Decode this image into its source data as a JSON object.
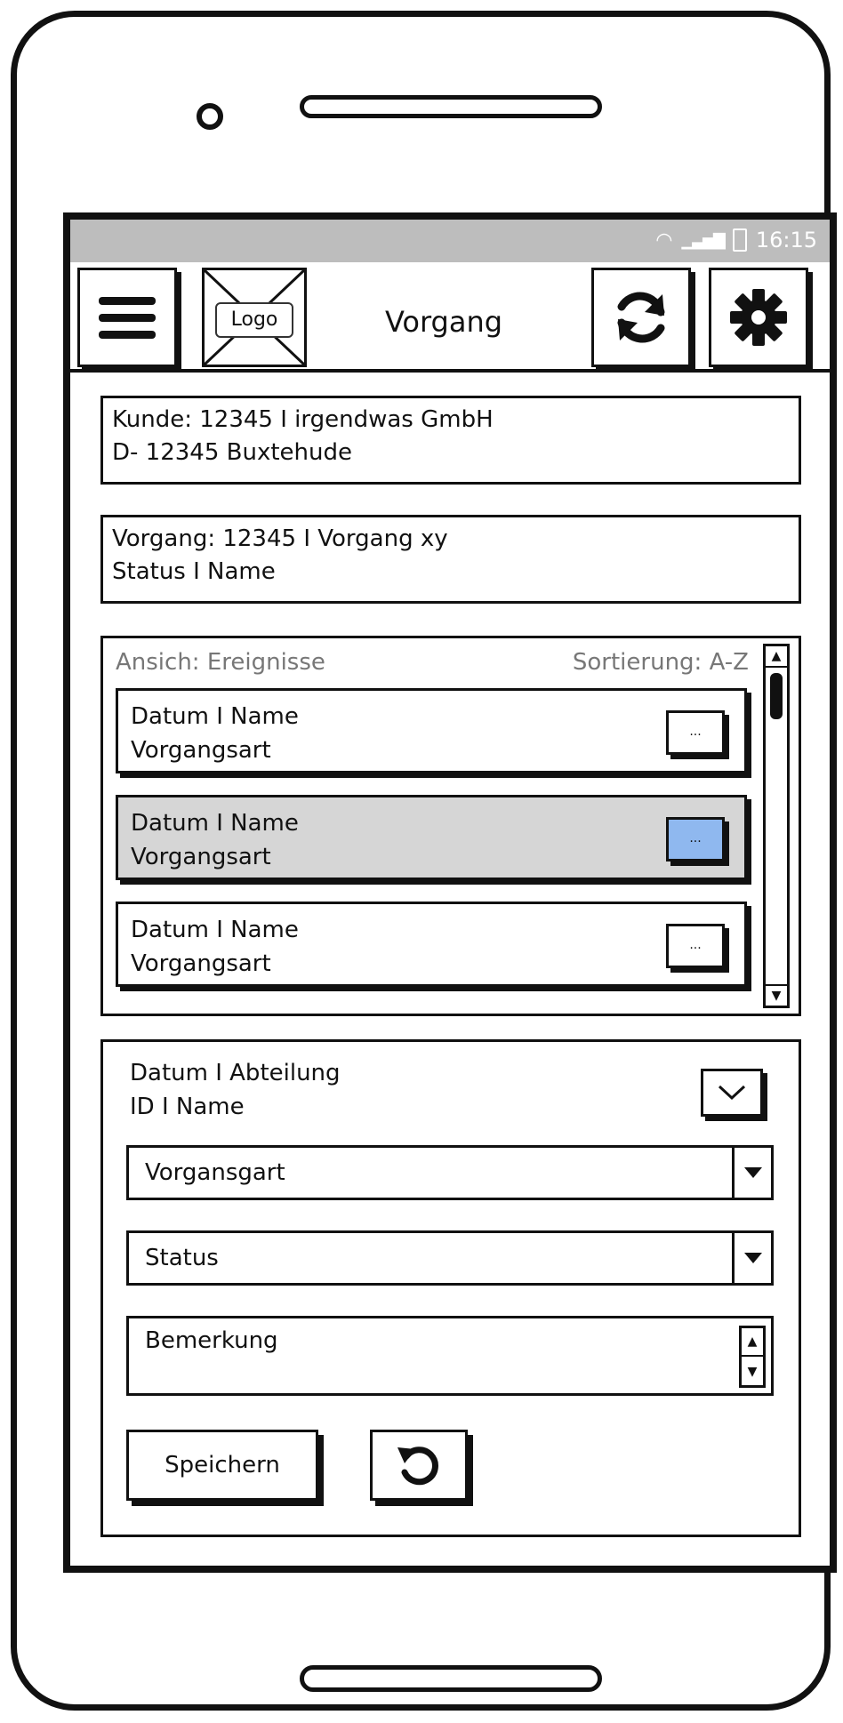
{
  "statusbar": {
    "time": "16:15",
    "wifi_icon": "wifi-icon",
    "signal_icon": "signal-icon",
    "battery_icon": "battery-icon"
  },
  "header": {
    "menu_icon": "hamburger-menu-icon",
    "logo_text": "Logo",
    "title": "Vorgang",
    "sync_icon": "sync-icon",
    "settings_icon": "gear-icon"
  },
  "customer": {
    "line1": "Kunde: 12345 I irgendwas GmbH",
    "line2": "D- 12345 Buxtehude"
  },
  "process": {
    "line1": "Vorgang: 12345 I Vorgang xy",
    "line2": "Status I Name"
  },
  "events": {
    "view_label": "Ansich: Ereignisse",
    "sort_label": "Sortierung: A-Z",
    "items": [
      {
        "line1": "Datum I Name",
        "line2": "Vorgangsart",
        "button": "...",
        "selected": false
      },
      {
        "line1": "Datum I Name",
        "line2": "Vorgangsart",
        "button": "...",
        "selected": true
      },
      {
        "line1": "Datum I Name",
        "line2": "Vorgangsart",
        "button": "...",
        "selected": false
      }
    ]
  },
  "detail": {
    "line1": "Datum I Abteilung",
    "line2": "ID I Name",
    "type_select": "Vorgansgart",
    "status_select": "Status",
    "remark_placeholder": "Bemerkung",
    "save_label": "Speichern",
    "undo_icon": "undo-icon"
  },
  "colors": {
    "selected_row": "#d6d6d6",
    "selected_button": "#8fb8ef",
    "statusbar": "#bdbdbd"
  }
}
